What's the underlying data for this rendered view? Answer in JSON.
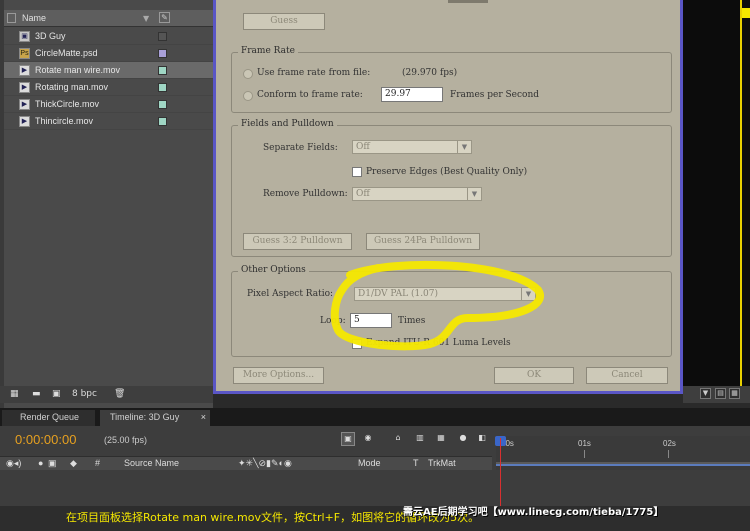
{
  "project_panel": {
    "header": {
      "name_label": "Name"
    },
    "items": [
      {
        "name": "3D Guy",
        "kind": "comp",
        "label_color": "#555555"
      },
      {
        "name": "CircleMatte.psd",
        "kind": "psd",
        "label_color": "#a9a0d8"
      },
      {
        "name": "Rotate man wire.mov",
        "kind": "mov",
        "label_color": "#9fd6c4",
        "selected": true
      },
      {
        "name": "Rotating man.mov",
        "kind": "mov",
        "label_color": "#9fd6c4"
      },
      {
        "name": "ThickCircle.mov",
        "kind": "mov",
        "label_color": "#9fd6c4"
      },
      {
        "name": "Thincircle.mov",
        "kind": "mov",
        "label_color": "#9fd6c4"
      }
    ],
    "footer": {
      "bpc": "8 bpc"
    }
  },
  "dialog": {
    "guess_button": "Guess",
    "frame_rate": {
      "title": "Frame Rate",
      "use_from_file": "Use frame rate from file:",
      "file_rate": "(29.970 fps)",
      "conform_label": "Conform to frame rate:",
      "conform_value": "29.97",
      "per_second": "Frames per Second"
    },
    "fields": {
      "title": "Fields and Pulldown",
      "separate_label": "Separate Fields:",
      "separate_value": "Off",
      "preserve_edges": "Preserve Edges (Best Quality Only)",
      "remove_label": "Remove Pulldown:",
      "remove_value": "Off",
      "guess_32": "Guess 3:2 Pulldown",
      "guess_24pa": "Guess 24Pa Pulldown"
    },
    "other": {
      "title": "Other Options",
      "pixel_aspect_label": "Pixel Aspect Ratio:",
      "pixel_aspect_value": "D1/DV PAL (1.07)",
      "loop_label": "Loop:",
      "loop_value": "5",
      "times": "Times",
      "luma_label": "Expand ITU-R 601 Luma Levels"
    },
    "more_options": "More Options...",
    "ok": "OK",
    "cancel": "Cancel"
  },
  "timeline": {
    "tabs": [
      "Render Queue",
      "Timeline: 3D Guy"
    ],
    "timecode": "0:00:00:00",
    "fps": "(25.00 fps)",
    "columns": {
      "hash": "#",
      "source_name": "Source Name",
      "mode": "Mode",
      "t": "T",
      "trkmat": "TrkMat"
    },
    "ruler": [
      "00s",
      "01s",
      "02s"
    ]
  },
  "caption": {
    "text": "在项目面板选择Rotate man wire.mov文件，按Ctrl+F，如图将它的循环改为5次。",
    "watermark": "需云AE后期学习吧【www.linecg.com/tieba/1775】",
    "highlight_color": "#f5e800"
  }
}
